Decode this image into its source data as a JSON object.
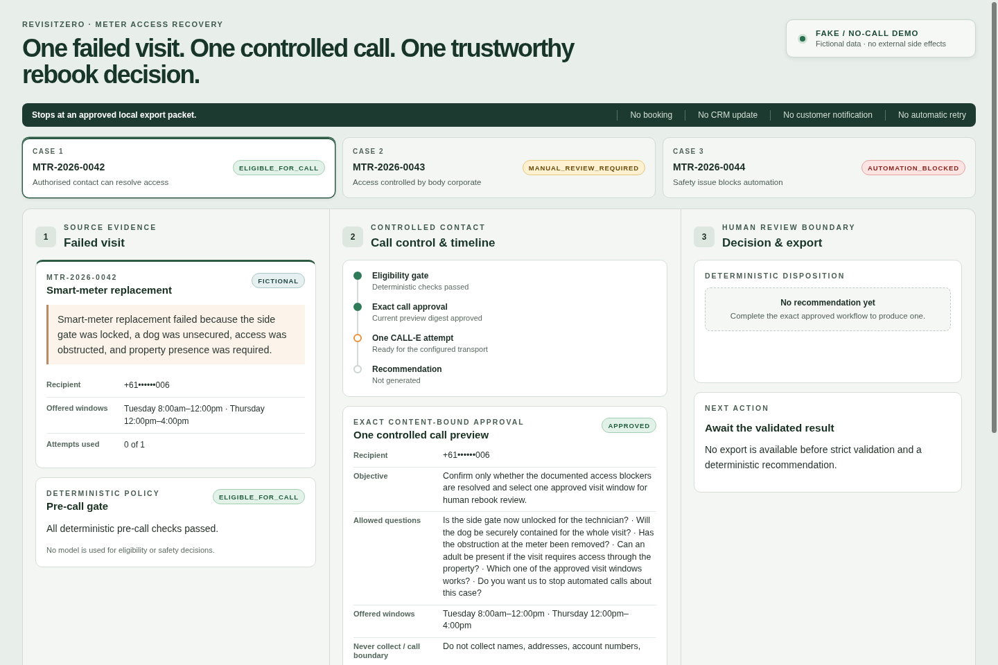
{
  "header": {
    "eyebrow": "REVISITZERO · METER ACCESS RECOVERY",
    "title": "One failed visit. One controlled call. One trustworthy rebook decision."
  },
  "demo_notice": {
    "title": "FAKE / NO-CALL DEMO",
    "subtitle": "Fictional data · no external side effects"
  },
  "scope_banner": {
    "text": "Stops at an approved local export packet.",
    "items": [
      "No booking",
      "No CRM update",
      "No customer notification",
      "No automatic retry"
    ]
  },
  "cases": [
    {
      "label": "CASE 1",
      "id": "MTR-2026-0042",
      "summary": "Authorised contact can resolve access",
      "badge": {
        "text": "ELIGIBLE_FOR_CALL",
        "kind": "eligible"
      },
      "selected": true
    },
    {
      "label": "CASE 2",
      "id": "MTR-2026-0043",
      "summary": "Access controlled by body corporate",
      "badge": {
        "text": "MANUAL_REVIEW_REQUIRED",
        "kind": "review"
      },
      "selected": false
    },
    {
      "label": "CASE 3",
      "id": "MTR-2026-0044",
      "summary": "Safety issue blocks automation",
      "badge": {
        "text": "AUTOMATION_BLOCKED",
        "kind": "blocked"
      },
      "selected": false
    }
  ],
  "columns": [
    {
      "step": "1",
      "eyebrow": "SOURCE EVIDENCE",
      "title": "Failed visit",
      "cards": [
        {
          "kind": "evidence",
          "eyebrow": "MTR-2026-0042",
          "title": "Smart-meter replacement",
          "badge": {
            "text": "FICTIONAL",
            "kind": "info"
          },
          "quote": "Smart-meter replacement failed because the side gate was locked, a dog was unsecured, access was obstructed, and property presence was required.",
          "rows": [
            {
              "label": "Recipient",
              "value": "+61••••••006"
            },
            {
              "label": "Offered windows",
              "value": "Tuesday 8:00am–12:00pm · Thursday 12:00pm–4:00pm"
            },
            {
              "label": "Attempts used",
              "value": "0 of 1"
            }
          ]
        },
        {
          "kind": "policy",
          "eyebrow": "DETERMINISTIC POLICY",
          "title": "Pre-call gate",
          "badge": {
            "text": "ELIGIBLE_FOR_CALL",
            "kind": "eligible"
          },
          "body": "All deterministic pre-call checks passed.",
          "note": "No model is used for eligibility or safety decisions."
        }
      ]
    },
    {
      "step": "2",
      "eyebrow": "CONTROLLED CONTACT",
      "title": "Call control & timeline",
      "cards": [
        {
          "kind": "timeline",
          "items": [
            {
              "title": "Eligibility gate",
              "detail": "Deterministic checks passed",
              "done": true,
              "active": false
            },
            {
              "title": "Exact call approval",
              "detail": "Current preview digest approved",
              "done": true,
              "active": false
            },
            {
              "title": "One CALL-E attempt",
              "detail": "Ready for the configured transport",
              "done": false,
              "active": true
            },
            {
              "title": "Recommendation",
              "detail": "Not generated",
              "done": false,
              "active": false
            }
          ]
        },
        {
          "kind": "details",
          "eyebrow": "EXACT CONTENT-BOUND APPROVAL",
          "title": "One controlled call preview",
          "badge": {
            "text": "APPROVED",
            "kind": "eligible"
          },
          "rows": [
            {
              "label": "Recipient",
              "value": "+61••••••006"
            },
            {
              "label": "Objective",
              "value": "Confirm only whether the documented access blockers are resolved and select one approved visit window for human rebook review."
            },
            {
              "label": "Allowed questions",
              "value": "Is the side gate now unlocked for the technician? · Will the dog be securely contained for the whole visit? · Has the obstruction at the meter been removed? · Can an adult be present if the visit requires access through the property? · Which one of the approved visit windows works? · Do you want us to stop automated calls about this case?"
            },
            {
              "label": "Offered windows",
              "value": "Tuesday 8:00am–12:00pm · Thursday 12:00pm–4:00pm"
            },
            {
              "label": "Never collect / call boundary",
              "value": "Do not collect names, addresses, account numbers,"
            }
          ]
        }
      ]
    },
    {
      "step": "3",
      "eyebrow": "HUMAN REVIEW BOUNDARY",
      "title": "Decision & export",
      "cards": [
        {
          "kind": "disposition",
          "eyebrow": "DETERMINISTIC DISPOSITION",
          "empty": {
            "title": "No recommendation yet",
            "text": "Complete the exact approved workflow to produce one."
          }
        },
        {
          "kind": "action",
          "eyebrow": "NEXT ACTION",
          "title": "Await the validated result",
          "body": "No export is available before strict validation and a deterministic recommendation."
        }
      ]
    }
  ]
}
